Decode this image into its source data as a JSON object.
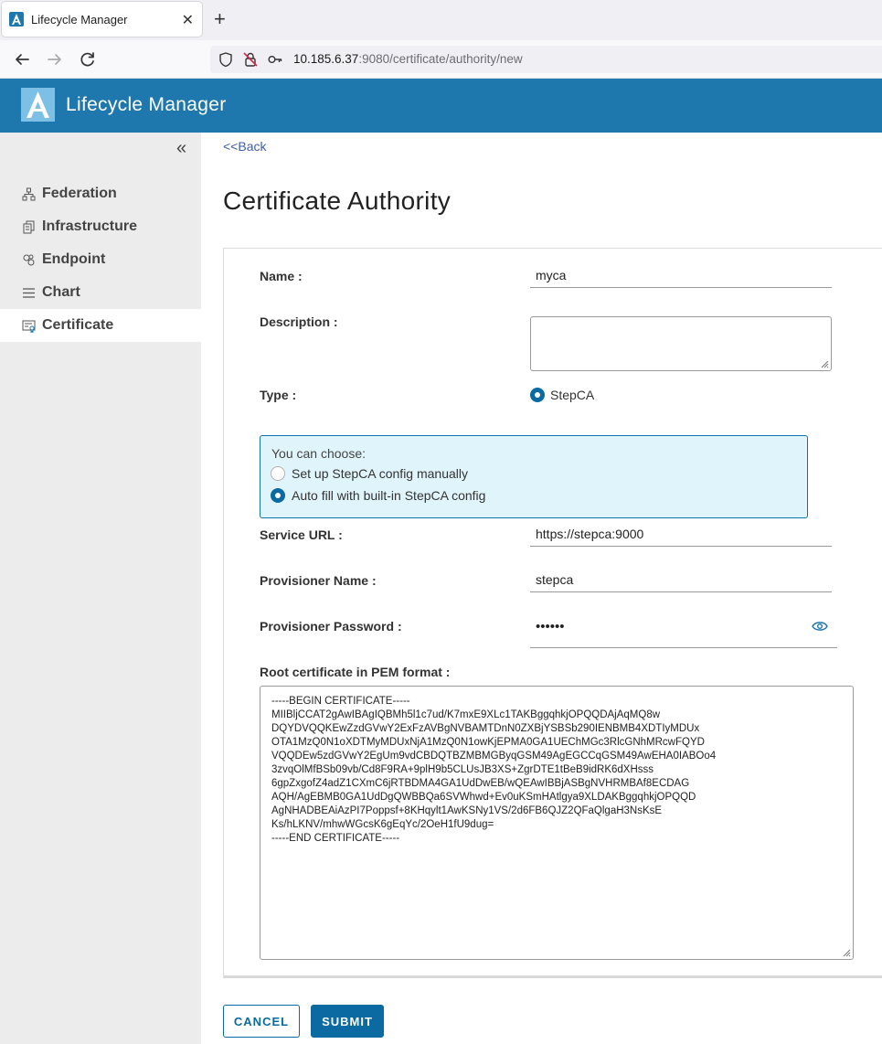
{
  "browser": {
    "tab_title": "Lifecycle Manager",
    "url_host": "10.185.6.37",
    "url_rest": ":9080/certificate/authority/new"
  },
  "app": {
    "title": "Lifecycle Manager"
  },
  "sidebar": {
    "items": [
      {
        "label": "Federation",
        "icon": "federation-icon"
      },
      {
        "label": "Infrastructure",
        "icon": "infrastructure-icon"
      },
      {
        "label": "Endpoint",
        "icon": "endpoint-icon"
      },
      {
        "label": "Chart",
        "icon": "chart-icon"
      },
      {
        "label": "Certificate",
        "icon": "certificate-icon",
        "active": true
      }
    ]
  },
  "page": {
    "back_label": "<<Back",
    "title": "Certificate Authority"
  },
  "form": {
    "name_label": "Name :",
    "name_value": "myca",
    "description_label": "Description :",
    "description_value": "",
    "type_label": "Type :",
    "type_value": "StepCA",
    "choose_title": "You can choose:",
    "choose_manual": "Set up StepCA config manually",
    "choose_auto": "Auto fill with built-in StepCA config",
    "choose_selected": "auto",
    "service_url_label": "Service URL :",
    "service_url_value": "https://stepca:9000",
    "provisioner_name_label": "Provisioner Name :",
    "provisioner_name_value": "stepca",
    "provisioner_password_label": "Provisioner Password :",
    "provisioner_password_value": "••••••",
    "pem_label": "Root certificate in PEM format :",
    "pem_lines": [
      "-----BEGIN CERTIFICATE-----",
      "MIIBljCCAT2gAwIBAgIQBMh5l1c7ud/K7mxE9XLc1TAKBggqhkjOPQQDAjAqMQ8w",
      "DQYDVQQKEwZzdGVwY2ExFzAVBgNVBAMTDnN0ZXBjYSBSb290IENBMB4XDTIyMDUx",
      "OTA1MzQ0N1oXDTMyMDUxNjA1MzQ0N1owKjEPMA0GA1UEChMGc3RlcGNhMRcwFQYD",
      "VQQDEw5zdGVwY2EgUm9vdCBDQTBZMBMGByqGSM49AgEGCCqGSM49AwEHA0IABOo4",
      "3zvqOlMfBSb09vb/Cd8F9RA+9plH9b5CLUsJB3XS+ZgrDTE1tBeB9idRK6dXHsss",
      "6gpZxgofZ4adZ1CXmC6jRTBDMA4GA1UdDwEB/wQEAwIBBjASBgNVHRMBAf8ECDAG",
      "AQH/AgEBMB0GA1UdDgQWBBQa6SVWhwd+Ev0uKSmHAtlgya9XLDAKBggqhkjOPQQD",
      "AgNHADBEAiAzPI7Poppsf+8KHqylt1AwKSNy1VS/2d6FB6QJZ2QFaQlgaH3NsKsE",
      "Ks/hLKNV/mhwWGcsK6gEqYc/2OeH1fU9dug=",
      "-----END CERTIFICATE-----"
    ]
  },
  "buttons": {
    "cancel": "CANCEL",
    "submit": "SUBMIT"
  },
  "colors": {
    "header": "#1f78ad",
    "accent": "#0a6aa1",
    "sidebar_bg": "#ececec",
    "info_box_bg": "#e0f4fb"
  }
}
